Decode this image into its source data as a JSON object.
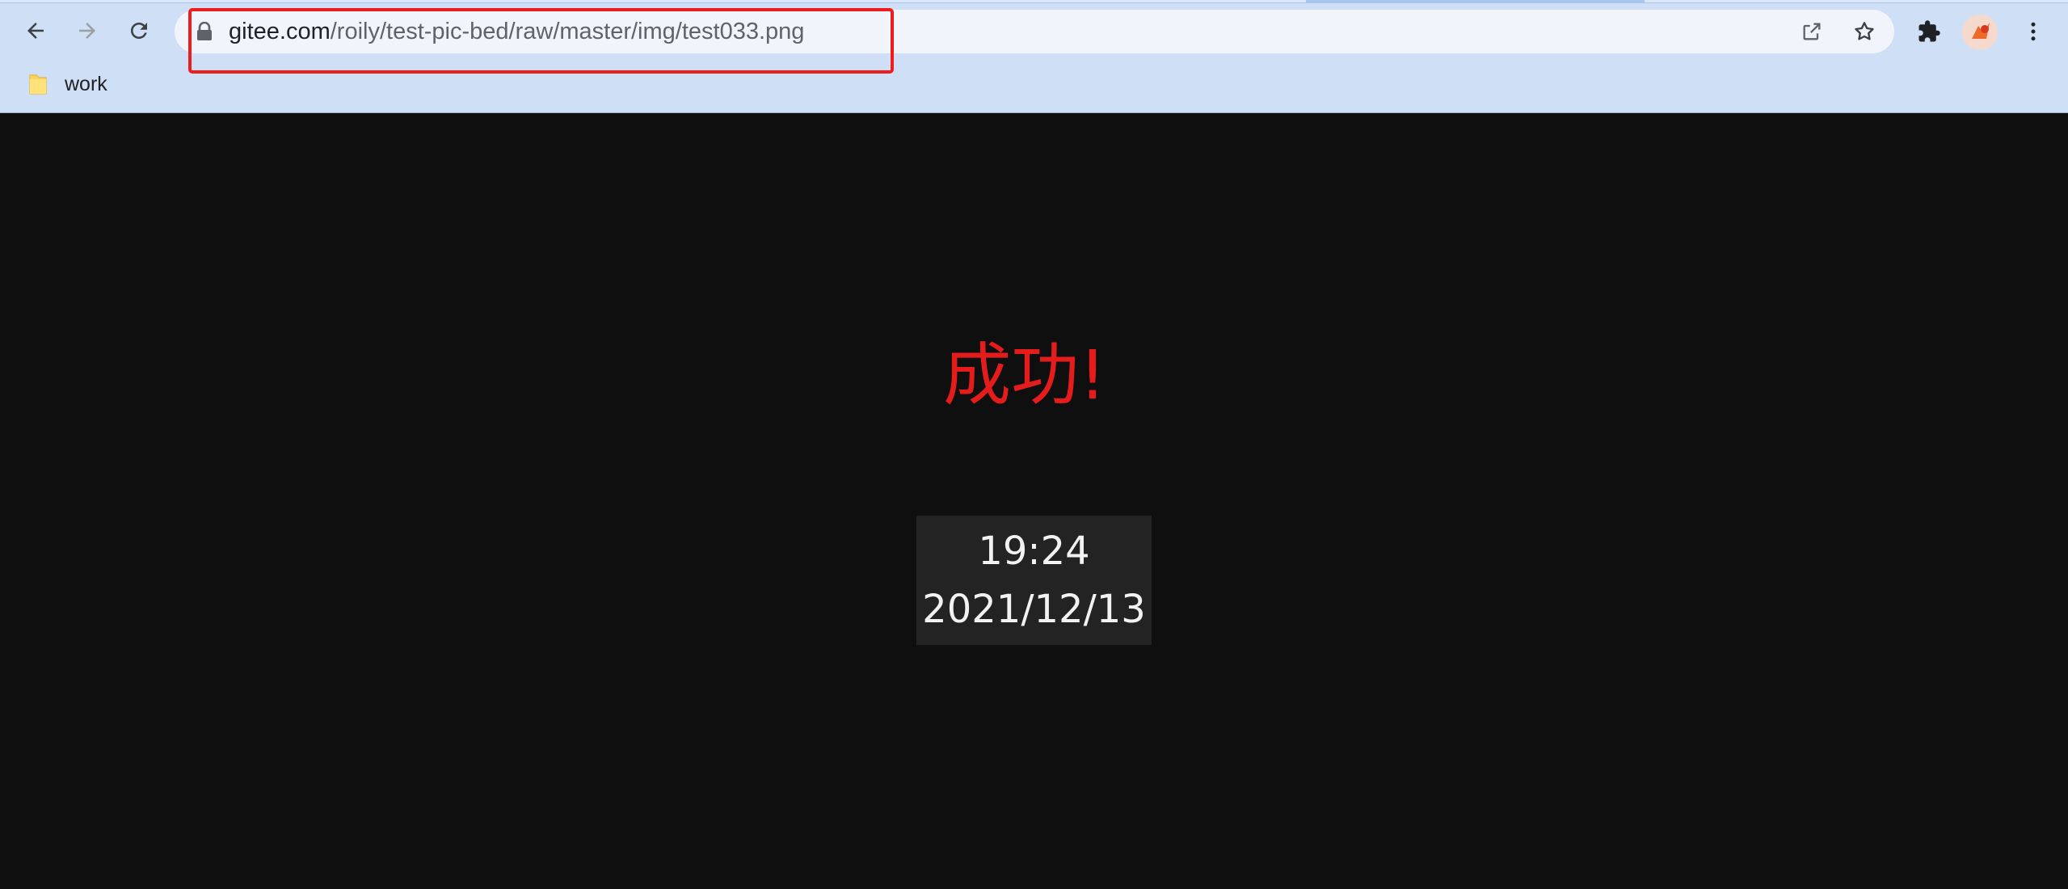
{
  "browser": {
    "address_bar": {
      "url_host": "gitee.com",
      "url_path": "/roily/test-pic-bed/raw/master/img/test033.png"
    },
    "nav": {
      "back_icon": "arrow-left-icon",
      "forward_icon": "arrow-right-icon",
      "reload_icon": "reload-icon"
    },
    "omnibox_icons": [
      "lock-icon",
      "share-icon",
      "star-icon"
    ],
    "toolbar_icons": [
      "extensions-puzzle-icon",
      "profile-avatar",
      "more-vertical-icon"
    ],
    "bookmarks": [
      {
        "label": "work",
        "icon": "folder-icon"
      }
    ]
  },
  "page": {
    "headline": "成功!",
    "clock": {
      "time": "19:24",
      "date": "2021/12/13"
    }
  },
  "colors": {
    "chrome_bg": "#cfdff6",
    "omnibox_bg": "#f1f5fb",
    "highlight": "#ee1d1d",
    "page_bg": "#0f0f0f",
    "headline": "#e51c1c",
    "clock_bg": "#232323",
    "clock_text": "#f2f2f2"
  }
}
